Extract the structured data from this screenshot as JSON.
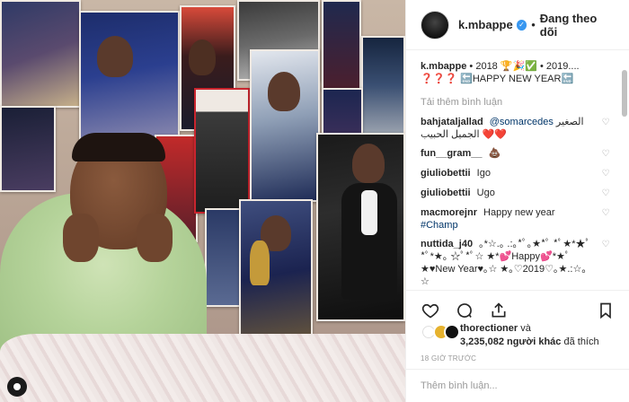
{
  "post": {
    "username": "k.mbappe",
    "follow_state": "Đang theo dõi",
    "separator": "•"
  },
  "caption": {
    "username": "k.mbappe",
    "text": "• 2018 🏆🎉✅ • 2019.... ❓❓❓ 🔚HAPPY NEW YEAR🔚"
  },
  "load_more": "Tải thêm bình luận",
  "comments": [
    {
      "username": "bahjataljallad",
      "mention": "@somarcedes",
      "text": "الصغير الجميل الحبيب ❤️❤️"
    },
    {
      "username": "fun__gram__",
      "mention": "",
      "text": "💩"
    },
    {
      "username": "giuliobettii",
      "mention": "",
      "text": "Igo"
    },
    {
      "username": "giuliobettii",
      "mention": "",
      "text": "Ugo"
    },
    {
      "username": "macmorejnr",
      "mention": "",
      "text": "Happy new year",
      "tag": "#Champ"
    },
    {
      "username": "nuttida_j40",
      "mention": "",
      "text": "｡*☆.｡ .:｡*ﾟ｡★*ﾟ *ﾟ★*★ﾟ*ﾟ*★｡ ☆ﾟ*ﾟ☆ ★*💕Happy💕*★ﾟ★♥New Year♥｡☆ ★｡♡2019♡｡★.:☆｡☆"
    }
  ],
  "likes": {
    "first_user": "thorectioner",
    "and": "và",
    "others": "3,235,082 người khác",
    "liked": "đã thích"
  },
  "timestamp": "18 GIỜ TRƯỚC",
  "add_comment": {
    "placeholder": "Thêm bình luận..."
  },
  "icons": {
    "heart": "heart-icon",
    "comment": "comment-icon",
    "share": "share-icon",
    "bookmark": "bookmark-icon",
    "verified": "verified-badge-icon"
  },
  "colors": {
    "accent": "#3897f0",
    "link": "#003569",
    "muted": "#999999"
  }
}
